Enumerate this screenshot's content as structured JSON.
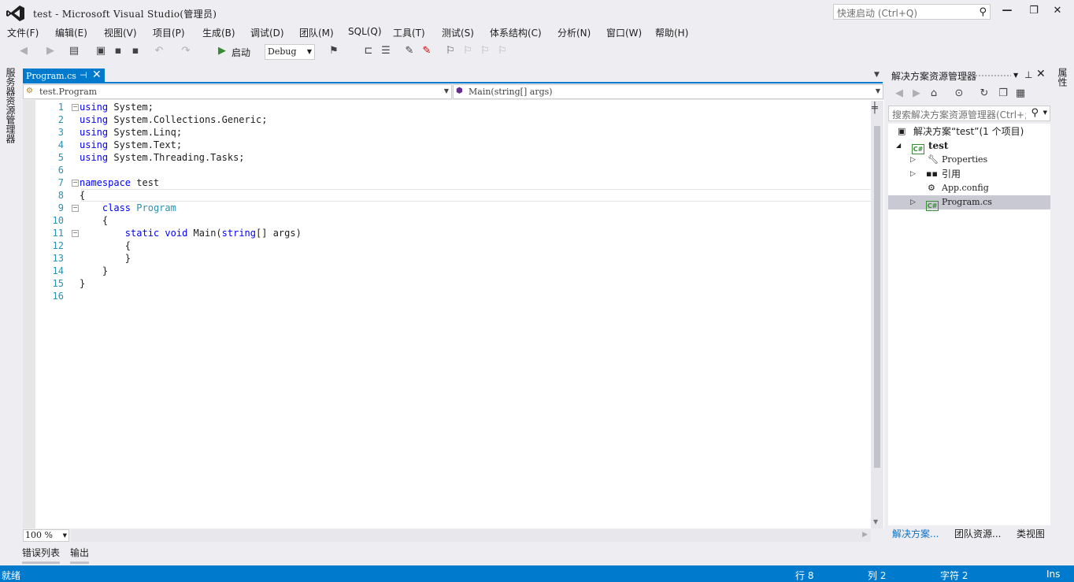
{
  "window": {
    "title": "test - Microsoft Visual Studio(管理员)",
    "quick_launch_placeholder": "快速启动 (Ctrl+Q)"
  },
  "menu": [
    "文件(F)",
    "编辑(E)",
    "视图(V)",
    "项目(P)",
    "生成(B)",
    "调试(D)",
    "团队(M)",
    "SQL(Q)",
    "工具(T)",
    "测试(S)",
    "体系结构(C)",
    "分析(N)",
    "窗口(W)",
    "帮助(H)"
  ],
  "toolbar": {
    "start_label": "启动",
    "config_value": "Debug"
  },
  "left_side_tab": "服务器资源管理器",
  "right_side_tab": "属性",
  "document_tab": {
    "label": "Program.cs",
    "pin": "⊣",
    "close": "✕"
  },
  "navigation": {
    "type_value": "test.Program",
    "member_value": "Main(string[] args)"
  },
  "code": {
    "lines": [
      [
        {
          "t": "using",
          "c": "kw"
        },
        {
          "t": " System;",
          "c": ""
        }
      ],
      [
        {
          "t": "using",
          "c": "kw"
        },
        {
          "t": " System.Collections.Generic;",
          "c": ""
        }
      ],
      [
        {
          "t": "using",
          "c": "kw"
        },
        {
          "t": " System.Linq;",
          "c": ""
        }
      ],
      [
        {
          "t": "using",
          "c": "kw"
        },
        {
          "t": " System.Text;",
          "c": ""
        }
      ],
      [
        {
          "t": "using",
          "c": "kw"
        },
        {
          "t": " System.Threading.Tasks;",
          "c": ""
        }
      ],
      [],
      [
        {
          "t": "namespace",
          "c": "kw"
        },
        {
          "t": " test",
          "c": ""
        }
      ],
      [
        {
          "t": "{",
          "c": ""
        }
      ],
      [
        {
          "t": "    ",
          "c": ""
        },
        {
          "t": "class",
          "c": "kw"
        },
        {
          "t": " ",
          "c": ""
        },
        {
          "t": "Program",
          "c": "ty"
        }
      ],
      [
        {
          "t": "    {",
          "c": ""
        }
      ],
      [
        {
          "t": "        ",
          "c": ""
        },
        {
          "t": "static",
          "c": "kw"
        },
        {
          "t": " ",
          "c": ""
        },
        {
          "t": "void",
          "c": "kw"
        },
        {
          "t": " Main(",
          "c": ""
        },
        {
          "t": "string",
          "c": "kw"
        },
        {
          "t": "[] args)",
          "c": ""
        }
      ],
      [
        {
          "t": "        {",
          "c": ""
        }
      ],
      [
        {
          "t": "        }",
          "c": ""
        }
      ],
      [
        {
          "t": "    }",
          "c": ""
        }
      ],
      [
        {
          "t": "}",
          "c": ""
        }
      ],
      []
    ],
    "folds": [
      1,
      7,
      9,
      11
    ],
    "cursor_line": 8
  },
  "zoom": "100 %",
  "bottom_tabs": [
    "错误列表",
    "输出"
  ],
  "status": {
    "state": "就绪",
    "line": "行 8",
    "col": "列 2",
    "char": "字符 2",
    "mode": "Ins"
  },
  "solution_explorer": {
    "title": "解决方案资源管理器",
    "search_placeholder": "搜索解决方案资源管理器(Ctrl+;)",
    "solution_label": "解决方案“test”(1 个项目)",
    "project": "test",
    "items": [
      "Properties",
      "引用",
      "App.config",
      "Program.cs"
    ],
    "bottom_tabs": [
      "解决方案...",
      "团队资源...",
      "类视图"
    ]
  },
  "colors": {
    "accent": "#007acc",
    "keyword": "#0000ff",
    "type": "#2b91af",
    "line_number": "#2b91af"
  }
}
